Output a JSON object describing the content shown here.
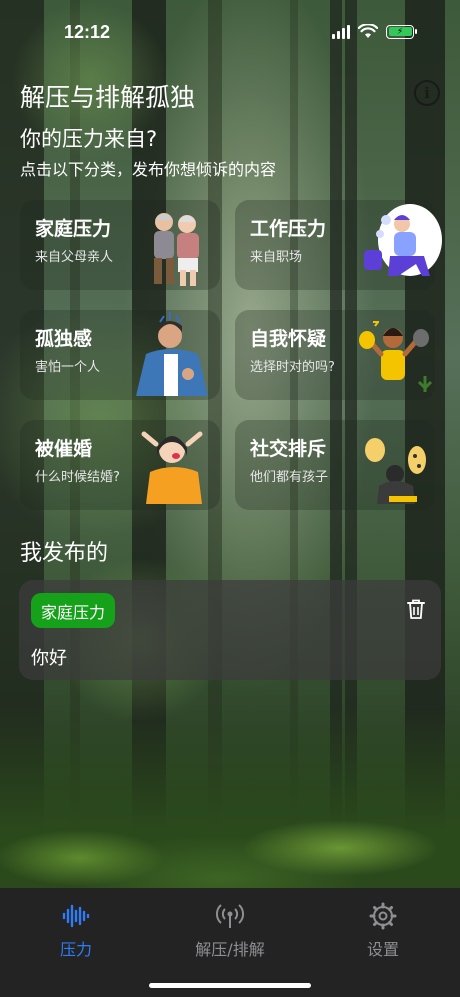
{
  "status": {
    "time": "12:12"
  },
  "header": {
    "app_title": "解压与排解孤独",
    "subtitle": "你的压力来自?",
    "hint": "点击以下分类，发布你想倾诉的内容"
  },
  "categories": [
    {
      "title": "家庭压力",
      "sub": "来自父母亲人",
      "icon": "elderly-couple-illustration"
    },
    {
      "title": "工作压力",
      "sub": "来自职场",
      "icon": "stressed-worker-illustration"
    },
    {
      "title": "孤独感",
      "sub": "害怕一个人",
      "icon": "lonely-person-illustration"
    },
    {
      "title": "自我怀疑",
      "sub": "选择时对的吗?",
      "icon": "self-doubt-illustration"
    },
    {
      "title": "被催婚",
      "sub": "什么时候结婚?",
      "icon": "frustrated-woman-illustration"
    },
    {
      "title": "社交排斥",
      "sub": "他们都有孩子",
      "icon": "excluded-person-illustration"
    }
  ],
  "my_posts": {
    "heading": "我发布的",
    "items": [
      {
        "tag": "家庭压力",
        "text": "你好"
      }
    ]
  },
  "tabbar": [
    {
      "label": "压力",
      "icon": "waveform-icon",
      "active": true
    },
    {
      "label": "解压/排解",
      "icon": "broadcast-icon",
      "active": false
    },
    {
      "label": "设置",
      "icon": "gear-icon",
      "active": false
    }
  ],
  "colors": {
    "accent": "#2f7cf6",
    "tag_green": "#15a11a",
    "tabbar_bg": "#232323"
  }
}
